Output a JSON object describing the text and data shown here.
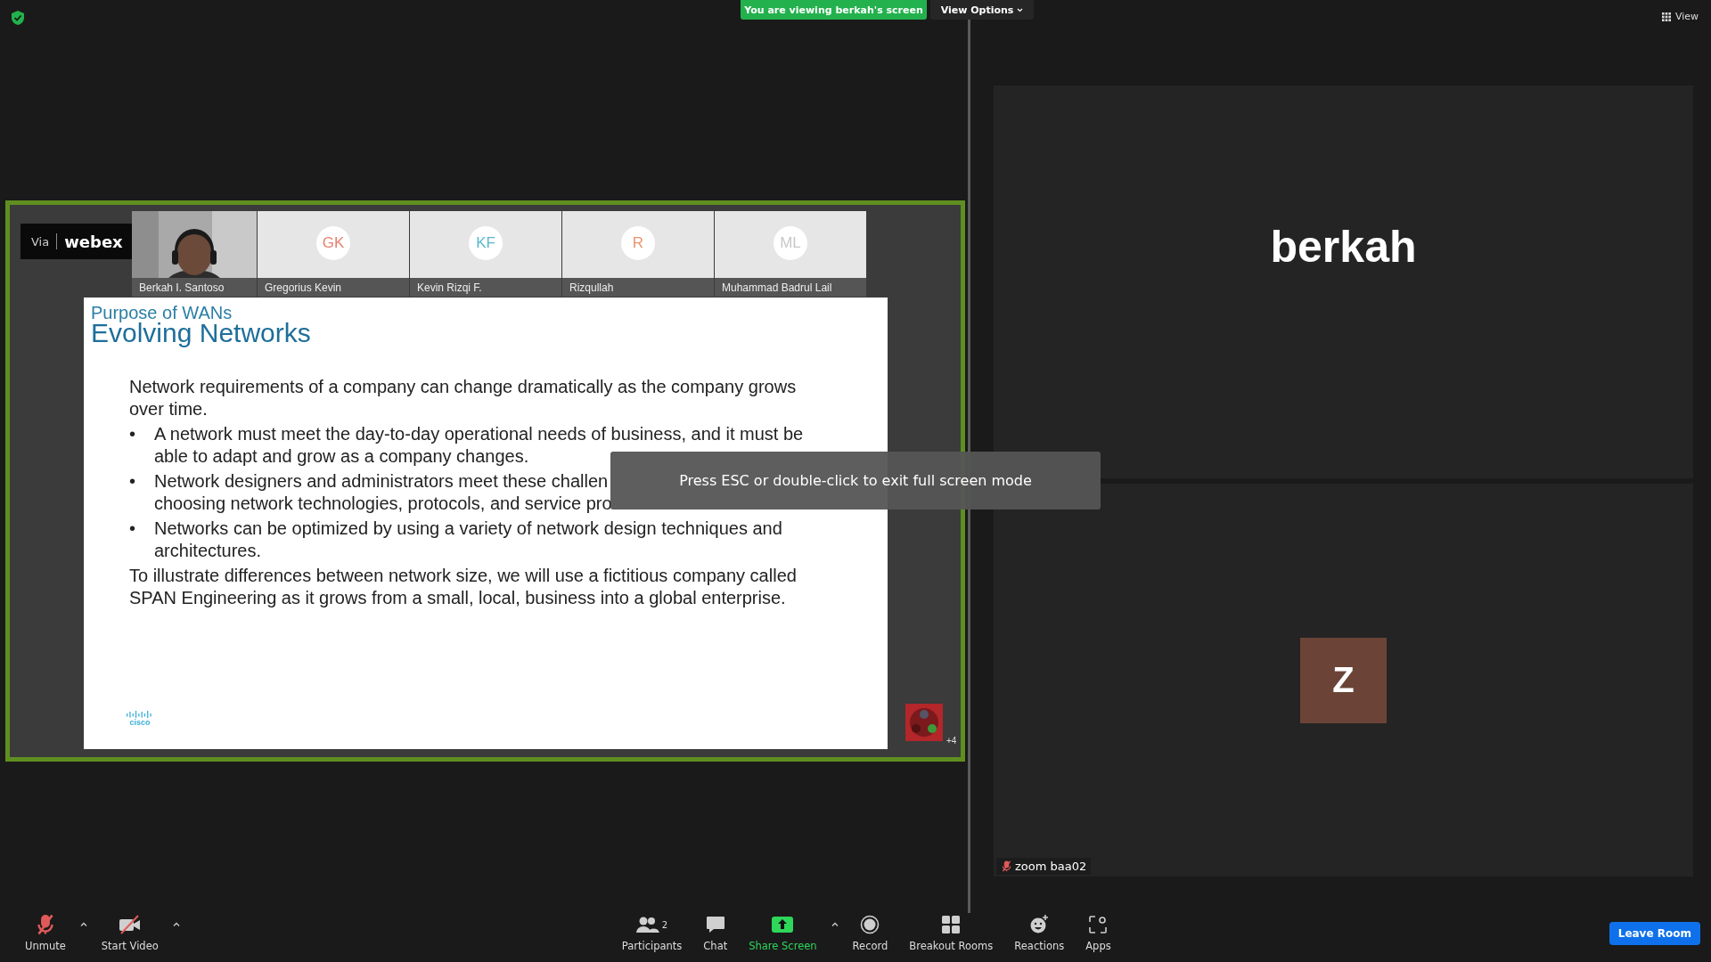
{
  "top_bar": {
    "viewing_banner": "You are viewing berkah's screen",
    "view_options": "View Options",
    "view": "View"
  },
  "shared_screen": {
    "webex_badge": {
      "via": "Via",
      "brand": "webex"
    },
    "participants": [
      {
        "kind": "video",
        "name": "Berkah I. Santoso"
      },
      {
        "kind": "avatar",
        "initials": "GK",
        "name": "Gregorius Kevin",
        "color": "#e8806e"
      },
      {
        "kind": "avatar",
        "initials": "KF",
        "name": "Kevin Rizqi F.",
        "color": "#5bb8cc"
      },
      {
        "kind": "avatar",
        "initials": "R",
        "name": "Rizqullah",
        "color": "#e8946e"
      },
      {
        "kind": "avatar",
        "initials": "ML",
        "name": "Muhammad Badrul Lail",
        "color": "#c8c8c8"
      }
    ],
    "slide": {
      "section": "Purpose of WANs",
      "title": "Evolving Networks",
      "paragraphs": [
        {
          "kind": "paragraph",
          "text": "Network requirements of a company can change dramatically as the company grows over time."
        },
        {
          "kind": "bullet",
          "marker": "•",
          "text": "A network must meet the day-to-day operational needs of business, and it must be able to adapt and grow as a company changes."
        },
        {
          "kind": "bullet_lines",
          "marker": "•",
          "lines": [
            "Network designers and administrators meet these challen",
            "choosing network technologies, protocols, and service pro"
          ]
        },
        {
          "kind": "bullet",
          "marker": "•",
          "text": "Networks can be optimized by using a variety of network design techniques and architectures."
        },
        {
          "kind": "paragraph",
          "text": "To illustrate differences between network size, we will use a fictitious company called SPAN Engineering as it grows from a small, local, business into a global enterprise."
        }
      ],
      "footer_logo": "cisco"
    },
    "overflow_count": "+4"
  },
  "toast": "Press ESC or double-click to exit full screen mode",
  "tiles": [
    {
      "kind": "name",
      "display": "berkah"
    },
    {
      "kind": "avatar",
      "display": "Z",
      "label": "zoom baa02",
      "muted": true
    }
  ],
  "toolbar": {
    "left": [
      {
        "kind": "mic",
        "label": "Unmute",
        "off": true,
        "caret": true
      },
      {
        "kind": "video",
        "label": "Start Video",
        "off": true,
        "caret": true
      }
    ],
    "center": [
      {
        "kind": "participants",
        "label": "Participants",
        "count": "2",
        "caret": false
      },
      {
        "kind": "chat",
        "label": "Chat",
        "caret": false
      },
      {
        "kind": "share",
        "label": "Share Screen",
        "caret": true
      },
      {
        "kind": "record",
        "label": "Record",
        "caret": false
      },
      {
        "kind": "breakout",
        "label": "Breakout Rooms",
        "caret": false
      },
      {
        "kind": "reactions",
        "label": "Reactions",
        "caret": false
      },
      {
        "kind": "apps",
        "label": "Apps",
        "caret": false
      }
    ],
    "leave": "Leave Room"
  }
}
